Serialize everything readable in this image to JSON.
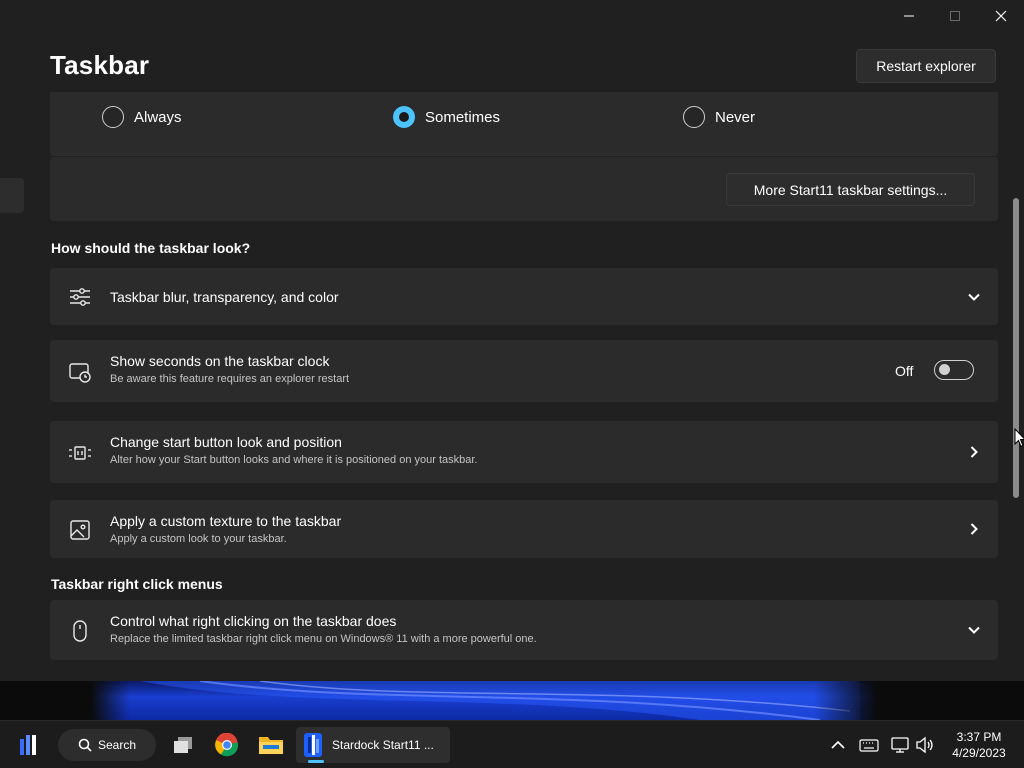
{
  "window": {
    "title": "Taskbar",
    "restart_label": "Restart explorer",
    "controls": [
      "minimize-icon",
      "maximize-icon",
      "close-icon"
    ]
  },
  "radio_group": {
    "options": [
      {
        "label": "Always",
        "checked": false
      },
      {
        "label": "Sometimes",
        "checked": true
      },
      {
        "label": "Never",
        "checked": false
      }
    ]
  },
  "more_settings_label": "More Start11 taskbar settings...",
  "sections": {
    "look_heading": "How should the taskbar look?",
    "right_click_heading": "Taskbar right click menus"
  },
  "rows": {
    "blur": {
      "title": "Taskbar blur, transparency, and color",
      "icon": "sliders-icon",
      "action": "chevron-down-icon"
    },
    "seconds": {
      "title": "Show seconds on the taskbar clock",
      "subtitle": "Be aware this feature requires an explorer restart",
      "icon": "clock-screen-icon",
      "toggle_label": "Off",
      "toggle_on": false
    },
    "start_button": {
      "title": "Change start button look and position",
      "subtitle": "Alter how your Start button looks and where it is positioned on your taskbar.",
      "icon": "start-button-icon",
      "action": "chevron-right-icon"
    },
    "texture": {
      "title": "Apply a custom texture to the taskbar",
      "subtitle": "Apply a custom look to your taskbar.",
      "icon": "image-icon",
      "action": "chevron-right-icon"
    },
    "right_click": {
      "title": "Control what right clicking on the taskbar does",
      "subtitle": "Replace the limited taskbar right click menu on Windows® 11 with a more powerful one.",
      "icon": "mouse-icon",
      "action": "chevron-down-icon"
    }
  },
  "taskbar": {
    "search_label": "Search",
    "active_app_label": "Stardock Start11 ...",
    "pinned_icons": [
      "start11-icon",
      "task-view-icon",
      "chrome-icon",
      "file-explorer-icon"
    ],
    "tray_icons": [
      "chevron-up-icon",
      "keyboard-icon",
      "network-icon",
      "volume-icon"
    ],
    "time": "3:37 PM",
    "date": "4/29/2023"
  },
  "colors": {
    "accent": "#4cc2ff",
    "background": "#202020",
    "card": "#2b2b2b"
  }
}
